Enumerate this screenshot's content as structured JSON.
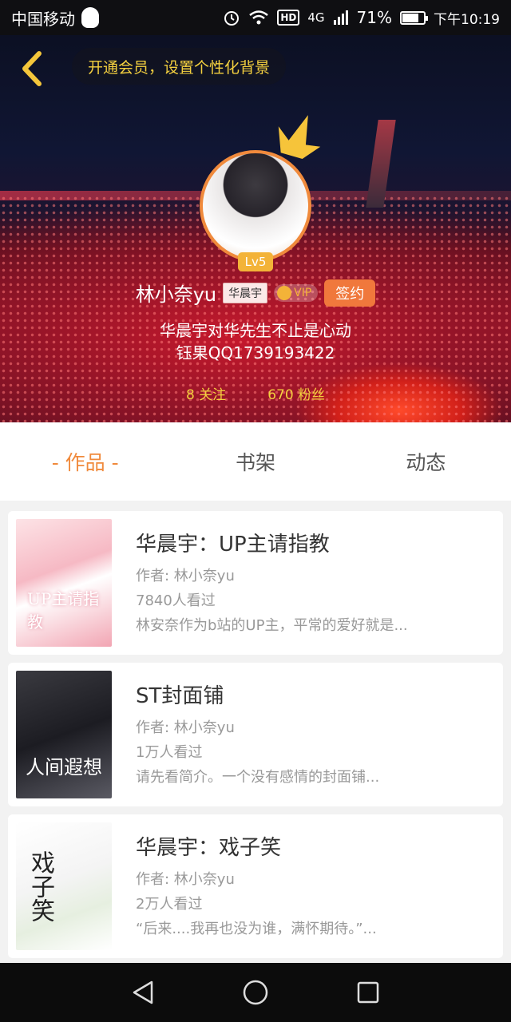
{
  "status": {
    "carrier": "中国移动",
    "hd": "HD",
    "network": "4G",
    "battery_pct": "71%",
    "battery_level": 0.71,
    "time": "下午10:19"
  },
  "header": {
    "vip_banner": "开通会员，设置个性化背景"
  },
  "profile": {
    "level": "Lv5",
    "username": "林小奈yu",
    "tag": "华晨宇",
    "vip": "VIP",
    "sign_label": "签约",
    "bio_line1": "华晨宇对华先生不止是心动",
    "bio_line2": "钰果QQ1739193422",
    "following": "8 关注",
    "followers": "670 粉丝"
  },
  "tabs": [
    "- 作品 -",
    "书架",
    "动态"
  ],
  "books": [
    {
      "title": "华晨宇：UP主请指教",
      "author": "作者: 林小奈yu",
      "views": "7840人看过",
      "desc": "林安奈作为b站的UP主，平常的爱好就是...",
      "cover_text": "UP主请指教"
    },
    {
      "title": "ST封面铺",
      "author": "作者: 林小奈yu",
      "views": "1万人看过",
      "desc": "请先看简介。一个没有感情的封面铺...",
      "cover_text": "人间遐想"
    },
    {
      "title": "华晨宇：戏子笑",
      "author": "作者: 林小奈yu",
      "views": "2万人看过",
      "desc": "“后来....我再也没为谁，满怀期待。”...",
      "cover_text": "戏子笑"
    }
  ],
  "colors": {
    "accent": "#f08a3c",
    "gold": "#f4d03f"
  }
}
